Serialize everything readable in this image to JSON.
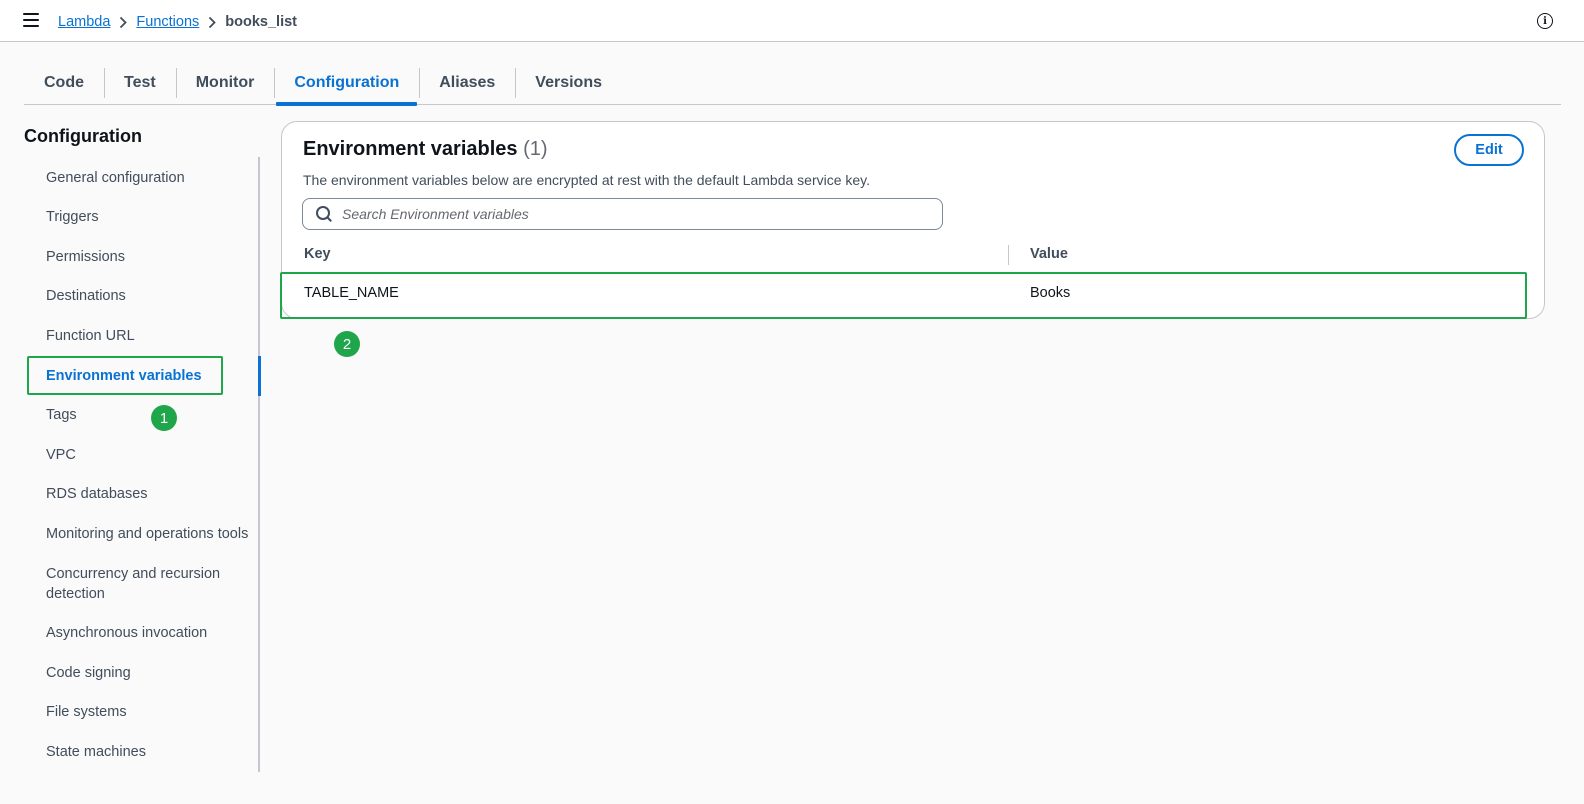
{
  "header": {
    "breadcrumb": {
      "lambda": "Lambda",
      "functions": "Functions",
      "current": "books_list"
    },
    "info_glyph": "i"
  },
  "tabs": [
    {
      "label": "Code"
    },
    {
      "label": "Test"
    },
    {
      "label": "Monitor"
    },
    {
      "label": "Configuration",
      "active": true
    },
    {
      "label": "Aliases"
    },
    {
      "label": "Versions"
    }
  ],
  "sidebar": {
    "title": "Configuration",
    "items": [
      {
        "label": "General configuration"
      },
      {
        "label": "Triggers"
      },
      {
        "label": "Permissions"
      },
      {
        "label": "Destinations"
      },
      {
        "label": "Function URL"
      },
      {
        "label": "Environment variables",
        "active": true
      },
      {
        "label": "Tags"
      },
      {
        "label": "VPC"
      },
      {
        "label": "RDS databases"
      },
      {
        "label": "Monitoring and operations tools"
      },
      {
        "label": "Concurrency and recursion detection"
      },
      {
        "label": "Asynchronous invocation"
      },
      {
        "label": "Code signing"
      },
      {
        "label": "File systems"
      },
      {
        "label": "State machines"
      }
    ]
  },
  "panel": {
    "title": "Environment variables",
    "count": "(1)",
    "description": "The environment variables below are encrypted at rest with the default Lambda service key.",
    "edit_label": "Edit",
    "search_placeholder": "Search Environment variables",
    "columns": {
      "key": "Key",
      "value": "Value"
    },
    "rows": [
      {
        "key": "TABLE_NAME",
        "value": "Books"
      }
    ]
  },
  "annotations": {
    "step1": "1",
    "step2": "2"
  },
  "colors": {
    "accent": "#0972d3",
    "highlight": "#1fa64a"
  }
}
